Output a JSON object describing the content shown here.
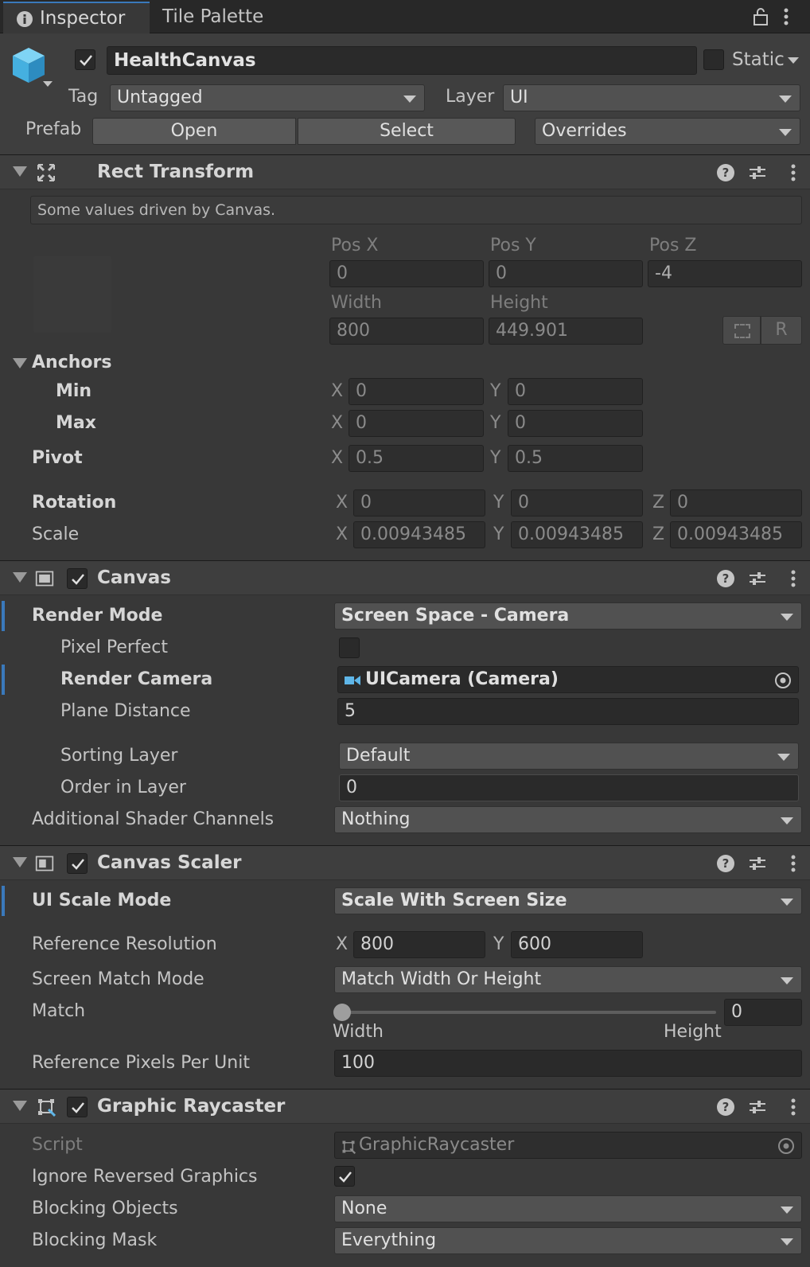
{
  "tabs": {
    "inspector": "Inspector",
    "tile_palette": "Tile Palette"
  },
  "object": {
    "name": "HealthCanvas",
    "static_label": "Static",
    "tag_label": "Tag",
    "tag_value": "Untagged",
    "layer_label": "Layer",
    "layer_value": "UI",
    "prefab_label": "Prefab",
    "open": "Open",
    "select": "Select",
    "overrides": "Overrides"
  },
  "rect": {
    "title": "Rect Transform",
    "info": "Some values driven by Canvas.",
    "pos_x_label": "Pos X",
    "pos_y_label": "Pos Y",
    "pos_z_label": "Pos Z",
    "pos_x": "0",
    "pos_y": "0",
    "pos_z": "-4",
    "width_label": "Width",
    "height_label": "Height",
    "width": "800",
    "height": "449.901",
    "r_button": "R",
    "anchors_label": "Anchors",
    "min_label": "Min",
    "min_x": "0",
    "min_y": "0",
    "max_label": "Max",
    "max_x": "0",
    "max_y": "0",
    "pivot_label": "Pivot",
    "pivot_x": "0.5",
    "pivot_y": "0.5",
    "rotation_label": "Rotation",
    "rot_x": "0",
    "rot_y": "0",
    "rot_z": "0",
    "scale_label": "Scale",
    "scale_x": "0.00943485",
    "scale_y": "0.00943485",
    "scale_z": "0.00943485",
    "x": "X",
    "y": "Y",
    "z": "Z"
  },
  "canvas": {
    "title": "Canvas",
    "render_mode_label": "Render Mode",
    "render_mode": "Screen Space - Camera",
    "pixel_perfect_label": "Pixel Perfect",
    "render_camera_label": "Render Camera",
    "render_camera": "UICamera (Camera)",
    "plane_distance_label": "Plane Distance",
    "plane_distance": "5",
    "sorting_layer_label": "Sorting Layer",
    "sorting_layer": "Default",
    "order_label": "Order in Layer",
    "order": "0",
    "shader_channels_label": "Additional Shader Channels",
    "shader_channels": "Nothing"
  },
  "scaler": {
    "title": "Canvas Scaler",
    "ui_scale_mode_label": "UI Scale Mode",
    "ui_scale_mode": "Scale With Screen Size",
    "ref_res_label": "Reference Resolution",
    "ref_x": "800",
    "ref_y": "600",
    "match_mode_label": "Screen Match Mode",
    "match_mode": "Match Width Or Height",
    "match_label": "Match",
    "match_value": "0",
    "match_fraction": 0,
    "width_label": "Width",
    "height_label": "Height",
    "ppu_label": "Reference Pixels Per Unit",
    "ppu": "100"
  },
  "raycaster": {
    "title": "Graphic Raycaster",
    "script_label": "Script",
    "script": "GraphicRaycaster",
    "ignore_label": "Ignore Reversed Graphics",
    "blocking_objects_label": "Blocking Objects",
    "blocking_objects": "None",
    "blocking_mask_label": "Blocking Mask",
    "blocking_mask": "Everything"
  },
  "colors": {
    "accent": "#3a79bb",
    "background": "#383838",
    "field": "#2a2a2a"
  }
}
